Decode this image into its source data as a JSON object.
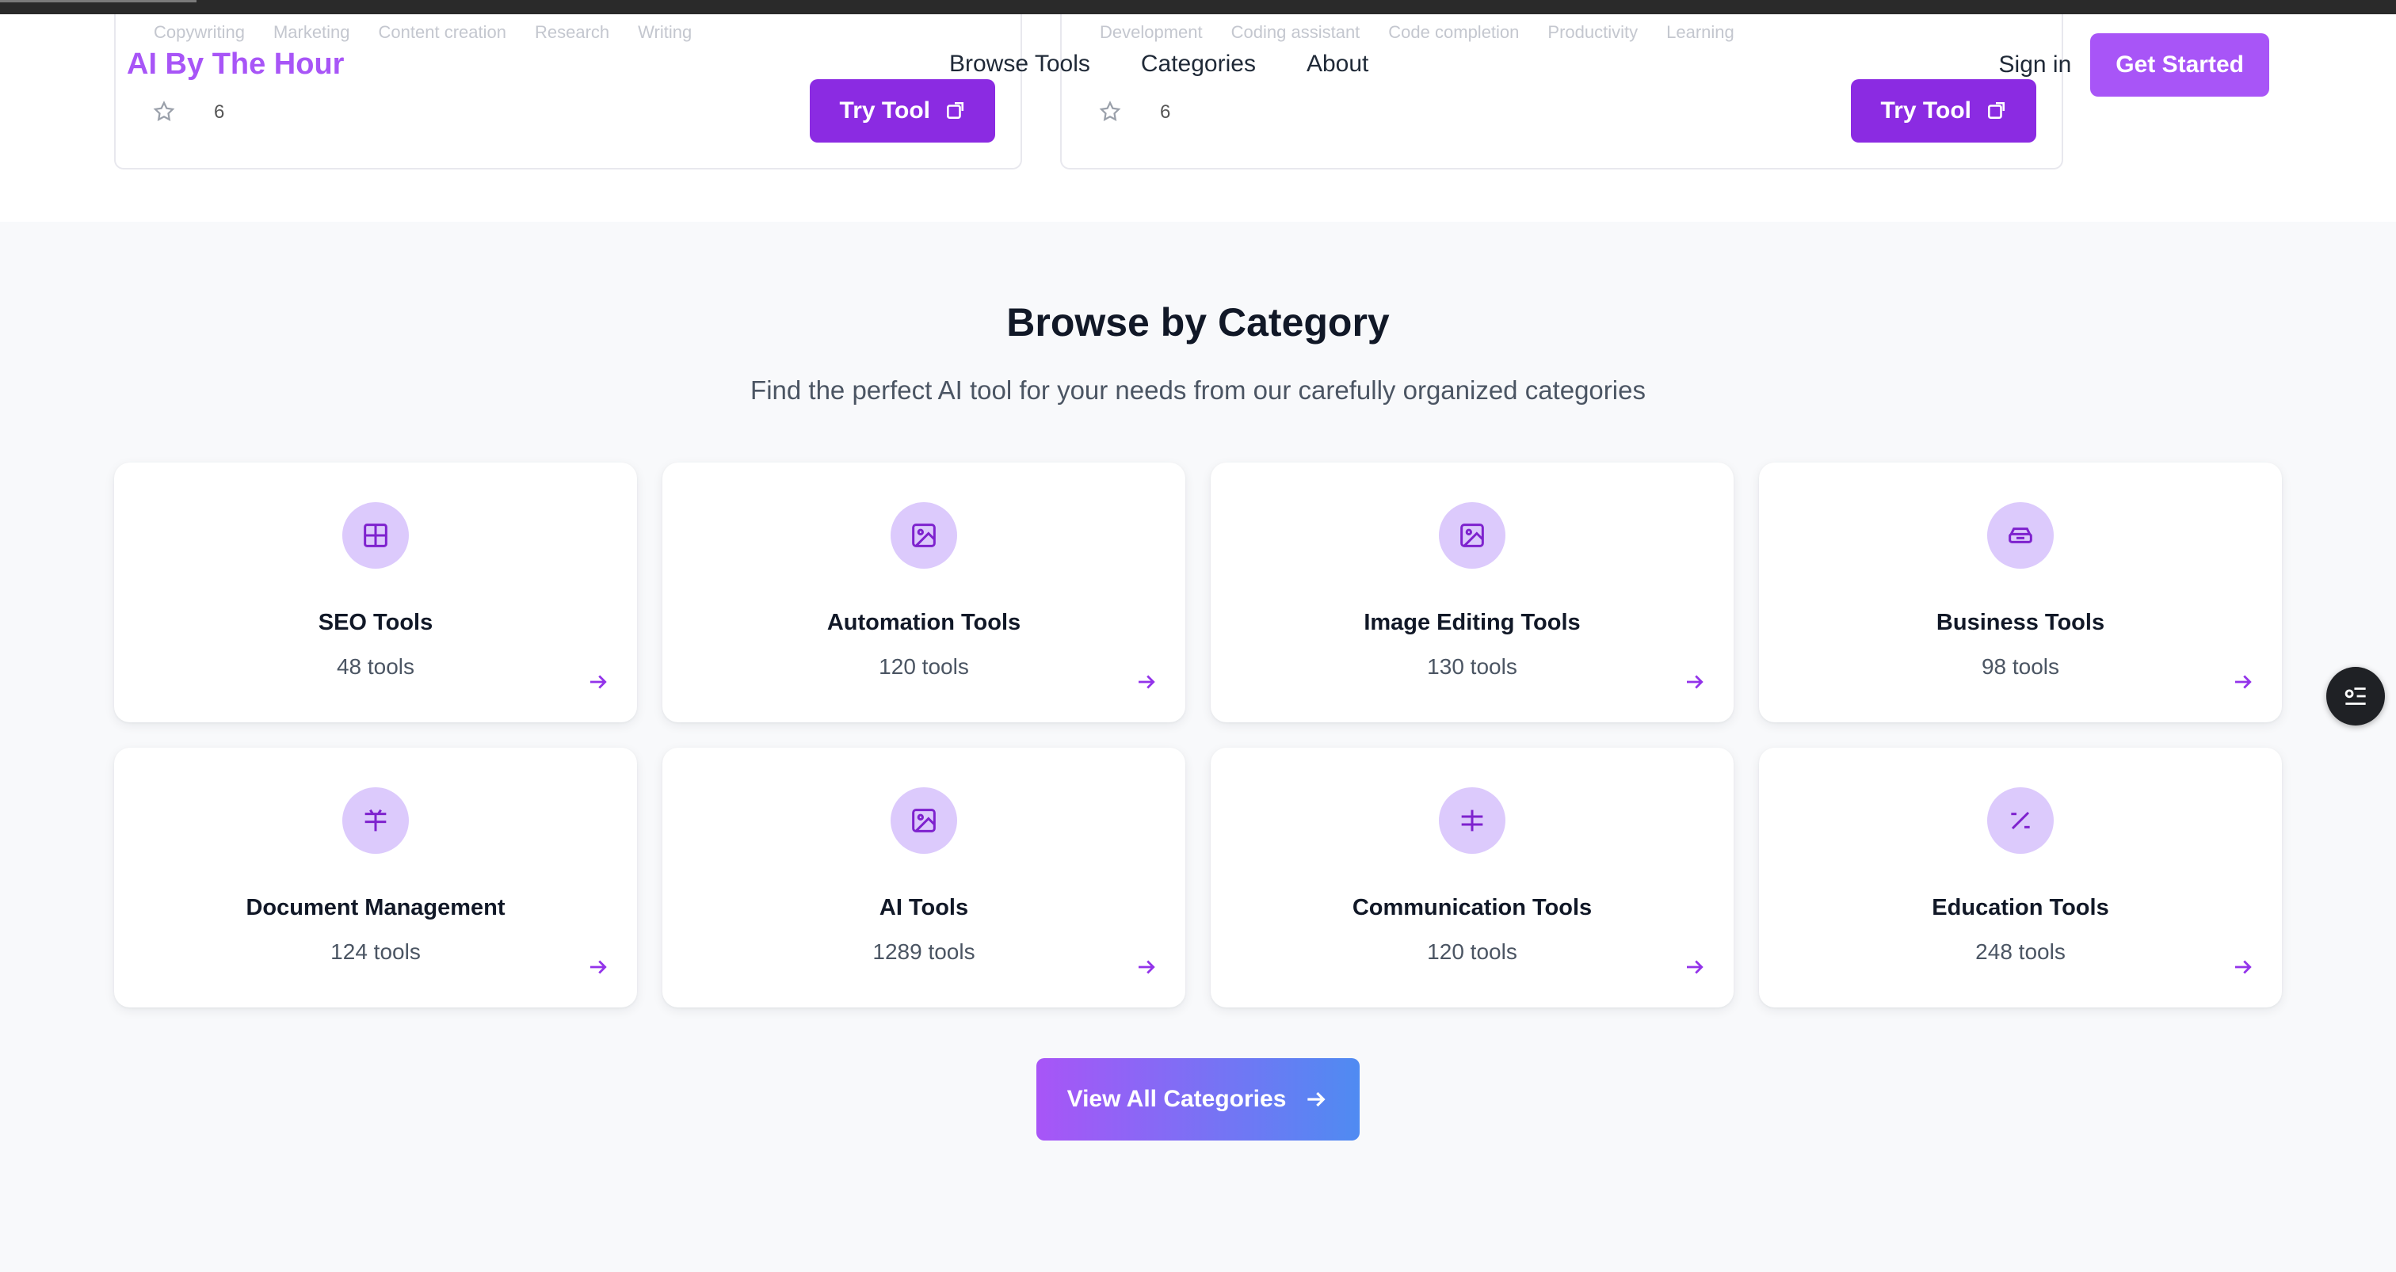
{
  "brand": {
    "logo": "AI By The Hour",
    "accent": "#a855f7"
  },
  "nav": {
    "browse_tools": "Browse Tools",
    "categories": "Categories",
    "about": "About"
  },
  "auth": {
    "sign_in": "Sign in",
    "get_started": "Get Started"
  },
  "tool_cards": [
    {
      "tags": [
        "Copywriting",
        "Marketing",
        "Content creation",
        "Research",
        "Writing"
      ],
      "count": "6",
      "button": "Try Tool"
    },
    {
      "tags": [
        "Development",
        "Coding assistant",
        "Code completion",
        "Productivity",
        "Learning"
      ],
      "count": "6",
      "button": "Try Tool"
    }
  ],
  "section": {
    "title": "Browse by Category",
    "subtitle": "Find the perfect AI tool for your needs from our carefully organized categories"
  },
  "categories": [
    {
      "name": "SEO Tools",
      "count": "48 tools",
      "icon": "grid-icon"
    },
    {
      "name": "Automation Tools",
      "count": "120 tools",
      "icon": "image-icon"
    },
    {
      "name": "Image Editing Tools",
      "count": "130 tools",
      "icon": "image-icon"
    },
    {
      "name": "Business Tools",
      "count": "98 tools",
      "icon": "briefcase-icon"
    },
    {
      "name": "Document Management",
      "count": "124 tools",
      "icon": "document-icon"
    },
    {
      "name": "AI Tools",
      "count": "1289 tools",
      "icon": "image-icon"
    },
    {
      "name": "Communication Tools",
      "count": "120 tools",
      "icon": "hash-icon"
    },
    {
      "name": "Education Tools",
      "count": "248 tools",
      "icon": "percent-icon"
    }
  ],
  "view_all": "View All Categories",
  "colors": {
    "icon_bg": "#dccafc",
    "icon_fg": "#7e22ce",
    "button_gradient_start": "#a855f7",
    "button_gradient_end": "#4f8bf2"
  }
}
